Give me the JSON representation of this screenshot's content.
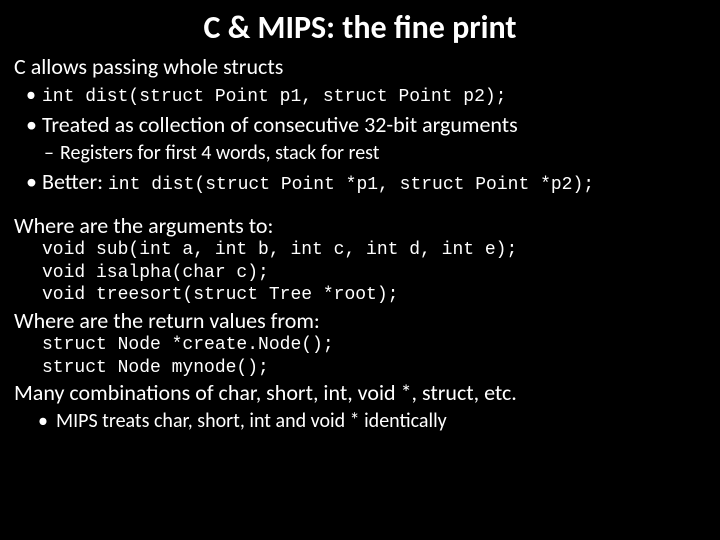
{
  "title": "C & MIPS: the fine print",
  "line_structs": "C allows passing whole structs",
  "bullet_dist": "int dist(struct Point p1, struct Point p2);",
  "bullet_treated": "Treated as collection of consecutive 32-bit arguments",
  "dash_registers": "Registers for first 4 words, stack for rest",
  "better_label": "Better: ",
  "better_code": "int dist(struct Point *p1, struct Point *p2);",
  "where_args": "Where are the arguments to:",
  "code_sub": "void sub(int a, int b, int c, int d, int e);",
  "code_isalpha": "void isalpha(char c);",
  "code_treesort": "void treesort(struct Tree *root);",
  "where_ret": "Where are the return values from:",
  "code_create": "struct Node *create.Node();",
  "code_mynode": "struct Node mynode();",
  "many_combo": "Many combinations of char, short, int, void *, struct, etc.",
  "mips_treats": "MIPS treats char, short, int and void * identically"
}
